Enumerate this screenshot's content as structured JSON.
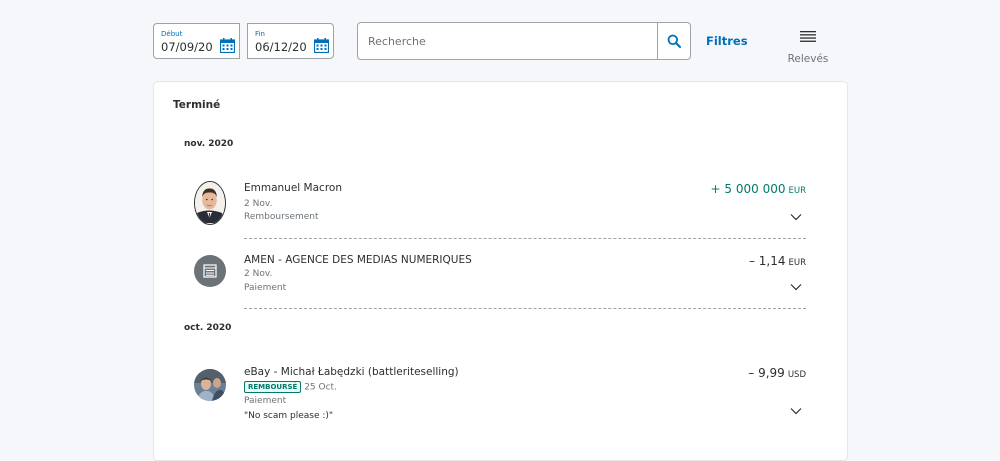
{
  "filters": {
    "start": {
      "label": "Début",
      "value": "07/09/20",
      "icon": "calendar-icon"
    },
    "end": {
      "label": "Fin",
      "value": "06/12/20",
      "icon": "calendar-icon"
    },
    "search_placeholder": "Recherche",
    "filters_label": "Filtres",
    "statements_label": "Relevés"
  },
  "colors": {
    "accent": "#0070ba",
    "positive": "#017a6b"
  },
  "activity": {
    "section_title": "Terminé",
    "groups": [
      {
        "month": "nov. 2020",
        "items": [
          {
            "name": "Emmanuel Macron",
            "date": "2 Nov.",
            "type": "Remboursement",
            "amount": "+ 5 000 000",
            "currency": "EUR",
            "avatar": "person-photo"
          },
          {
            "name": "AMEN - AGENCE DES MEDIAS NUMERIQUES",
            "date": "2 Nov.",
            "type": "Paiement",
            "amount": "– 1,14",
            "currency": "EUR",
            "avatar": "store-icon"
          }
        ]
      },
      {
        "month": "oct. 2020",
        "items": [
          {
            "name": "eBay - Michał Łabędzki (battleriteselling)",
            "badge": "REMBOURSÉ",
            "date": "25 Oct.",
            "type": "Paiement",
            "note": "\"No scam please :)\"",
            "amount": "– 9,99",
            "currency": "USD",
            "avatar": "person-photo"
          }
        ]
      }
    ]
  }
}
